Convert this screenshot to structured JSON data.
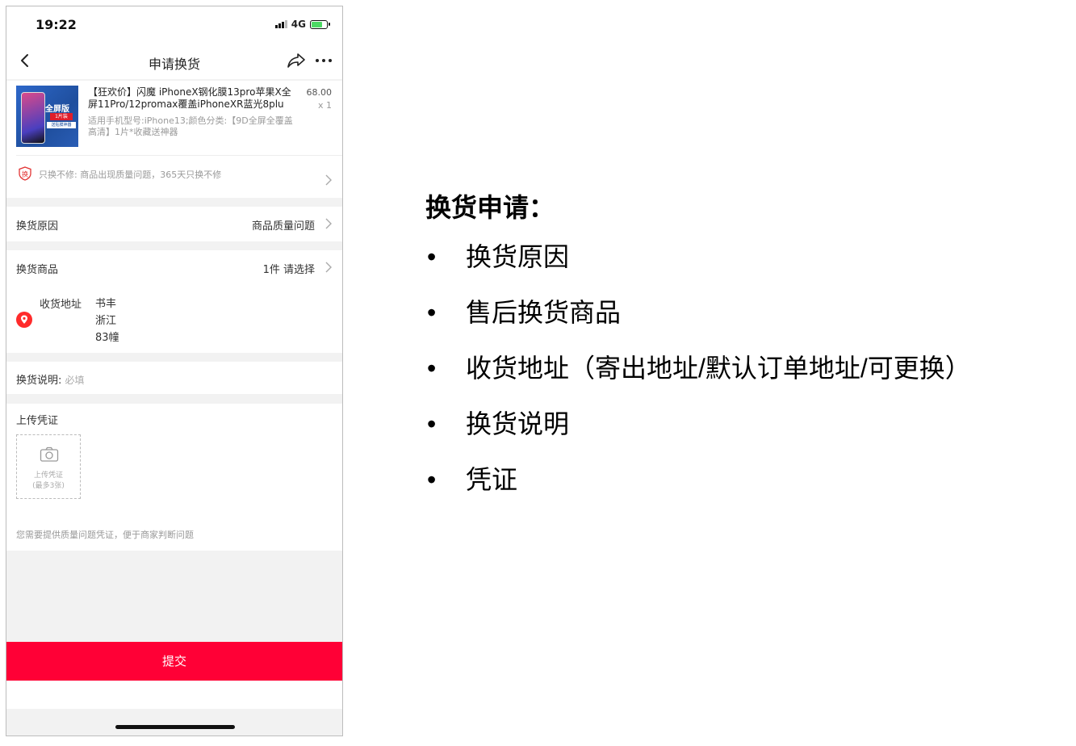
{
  "status": {
    "time": "19:22",
    "network": "4G"
  },
  "nav": {
    "title": "申请换货"
  },
  "product": {
    "name": "【狂欢价】闪魔 iPhoneX钢化膜13pro苹果X全屏11Pro/12promax覆盖iPhoneXR蓝光8plu",
    "price": "68.00",
    "qty": "x 1",
    "spec": "适用手机型号:iPhone13;颜色分类:【9D全屏全覆盖高清】1片*收藏送神器",
    "thumb_text_1": "全屏版",
    "thumb_text_2": "1片装",
    "thumb_text_3": "送贴膜神器"
  },
  "guarantee": {
    "icon_char": "换",
    "text": "只换不修: 商品出现质量问题，365天只换不修"
  },
  "reason": {
    "label": "换货原因",
    "value": "商品质量问题"
  },
  "goods": {
    "label": "换货商品",
    "count": "1件",
    "action": "请选择",
    "address_label": "收货地址",
    "address_name": "书丰",
    "address_line1": "浙江",
    "address_line2": "83幢"
  },
  "explain": {
    "label": "换货说明:",
    "placeholder": "必填"
  },
  "upload": {
    "label": "上传凭证",
    "box_line1": "上传凭证",
    "box_line2": "(最多3张)",
    "hint": "您需要提供质量问题凭证，便于商家判断问题"
  },
  "submit_label": "提交",
  "colors": {
    "accent": "#ff0036",
    "background": "#f2f2f2"
  },
  "icons": [
    "back-icon",
    "share-icon",
    "more-icon",
    "guarantee-icon",
    "chevron-right-icon",
    "location-pin-icon",
    "camera-icon"
  ],
  "notes": {
    "title": "换货申请：",
    "items": [
      "换货原因",
      "售后换货商品",
      "收货地址（寄出地址/默认订单地址/可更换）",
      "换货说明",
      "凭证"
    ],
    "bullet": "•"
  }
}
